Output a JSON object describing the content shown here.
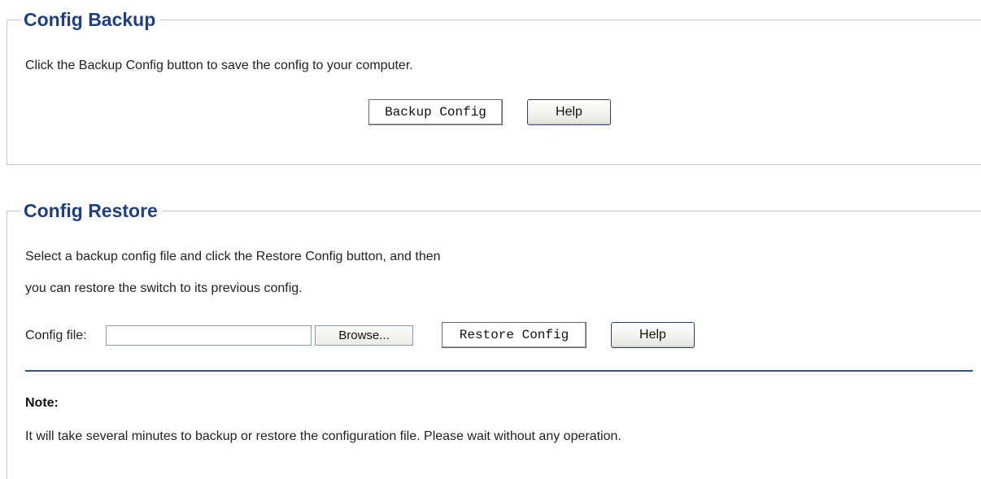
{
  "backup": {
    "title": "Config Backup",
    "description": "Click the Backup Config button to save the config to your computer.",
    "backup_button": "Backup Config",
    "help_button": "Help"
  },
  "restore": {
    "title": "Config Restore",
    "description_line1": "Select a backup config file and click the Restore Config button, and then",
    "description_line2": "you can restore the switch to its previous config.",
    "file_label": "Config file:",
    "file_value": "",
    "browse_button": "Browse...",
    "restore_button": "Restore Config",
    "help_button": "Help"
  },
  "note": {
    "title": "Note:",
    "text": "It will take several minutes to backup or restore the configuration file. Please wait without any operation."
  },
  "colors": {
    "heading": "#1f3f84",
    "divider": "#2f5387",
    "frame_border": "#c9c9c9"
  }
}
